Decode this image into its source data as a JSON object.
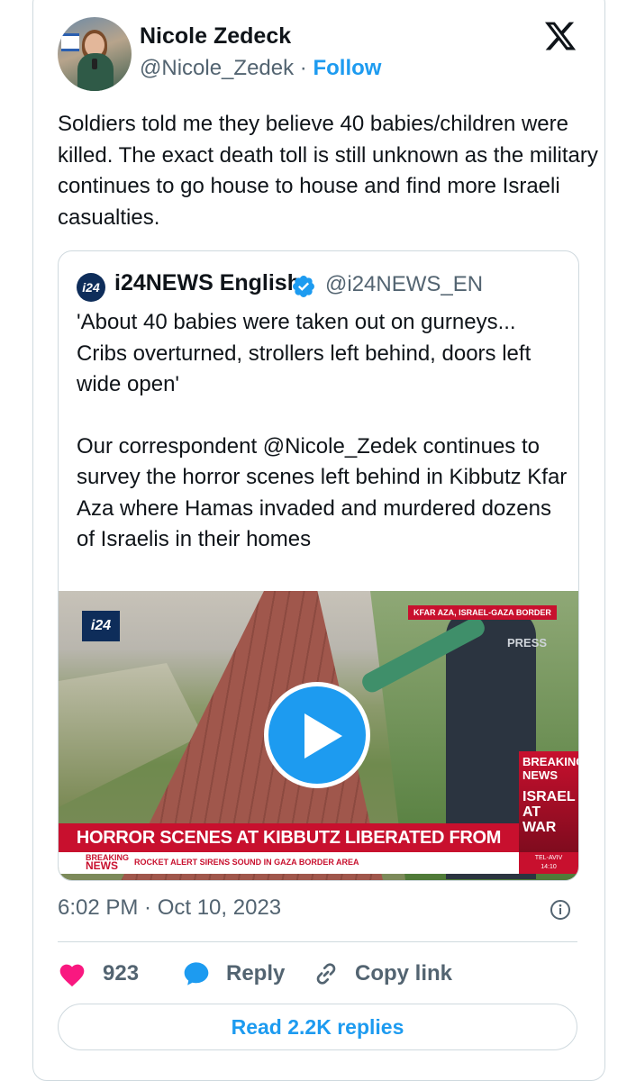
{
  "author": {
    "name": "Nicole Zedeck",
    "handle": "@Nicole_Zedek",
    "separator": "·",
    "follow_label": "Follow"
  },
  "tweet": {
    "text": "Soldiers told me they believe 40 babies/children were killed. The exact death toll is still unknown as the military continues to go house to house and find more Israeli casualties.",
    "timestamp": "6:02 PM · Oct 10, 2023"
  },
  "quote": {
    "logo_text": "i24",
    "name": "i24NEWS English",
    "handle": "@i24NEWS_EN",
    "paragraphs": [
      "'About 40 babies were taken out on gurneys... Cribs overturned, strollers left behind, doors left wide open'",
      "Our correspondent @Nicole_Zedek continues to survey the horror scenes left behind in Kibbutz Kfar Aza where Hamas invaded and murdered dozens of Israelis in their homes"
    ]
  },
  "video": {
    "channel_logo": "i24",
    "location": "KFAR AZA, ISRAEL-GAZA BORDER",
    "vest_text": "PRESS",
    "breaking_box": [
      "BREAKING",
      "NEWS"
    ],
    "war_box": [
      "ISRAEL",
      "AT",
      "WAR"
    ],
    "headline": "HORROR SCENES AT KIBBUTZ LIBERATED FROM HAMAS",
    "ticker_label_top": "BREAKING",
    "ticker_label_bottom": "NEWS",
    "ticker_text": "ROCKET ALERT SIRENS SOUND IN GAZA BORDER AREA",
    "ticker_city": "TEL-AVIV",
    "ticker_time": "14:10"
  },
  "actions": {
    "likes": "923",
    "reply_label": "Reply",
    "copy_label": "Copy link"
  },
  "read_replies_label": "Read 2.2K replies",
  "colors": {
    "accent": "#1d9bf0",
    "like": "#f91880",
    "secondary_text": "#536471",
    "border": "#cfd9de",
    "news_red": "#c8102e"
  }
}
